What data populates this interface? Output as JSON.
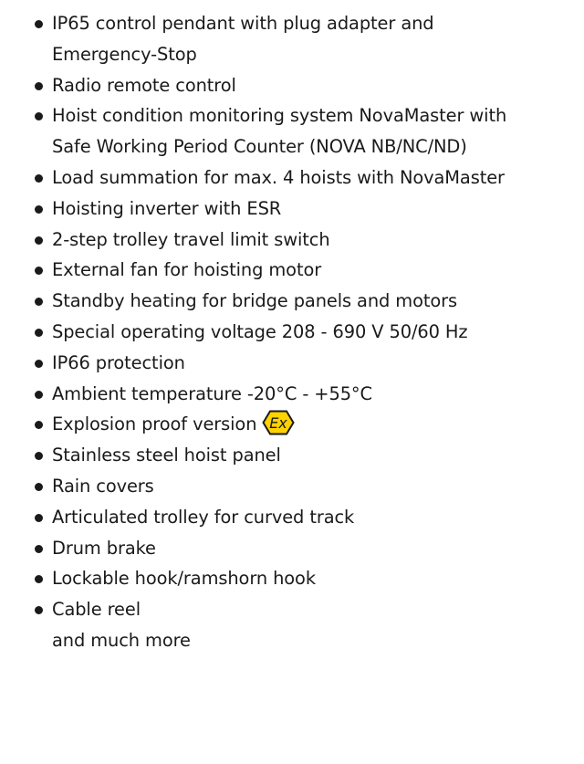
{
  "features": {
    "items": [
      {
        "lines": [
          "IP65 control pendant with plug adapter and",
          "Emergency-Stop"
        ]
      },
      {
        "lines": [
          "Radio remote control"
        ]
      },
      {
        "lines": [
          "Hoist condition monitoring system NovaMaster with",
          "Safe Working Period Counter (NOVA NB/NC/ND)"
        ]
      },
      {
        "lines": [
          "Load summation for max. 4 hoists with NovaMaster"
        ]
      },
      {
        "lines": [
          "Hoisting inverter with ESR"
        ]
      },
      {
        "lines": [
          "2-step trolley travel limit switch"
        ]
      },
      {
        "lines": [
          "External fan for hoisting motor"
        ]
      },
      {
        "lines": [
          "Standby heating for bridge panels and motors"
        ]
      },
      {
        "lines": [
          "Special operating voltage 208 - 690 V 50/60 Hz"
        ]
      },
      {
        "lines": [
          "IP66 protection"
        ]
      },
      {
        "lines": [
          "Ambient temperature -20°C - +55°C"
        ]
      },
      {
        "lines": [
          "Explosion proof version"
        ],
        "icon": "ex-explosion-proof-icon",
        "icon_text": "Ex"
      },
      {
        "lines": [
          "Stainless steel hoist panel"
        ]
      },
      {
        "lines": [
          "Rain covers"
        ]
      },
      {
        "lines": [
          "Articulated trolley for curved track"
        ]
      },
      {
        "lines": [
          "Drum brake"
        ]
      },
      {
        "lines": [
          "Lockable hook/ramshorn hook"
        ]
      },
      {
        "lines": [
          "Cable reel"
        ]
      }
    ],
    "footer": "and much more"
  },
  "colors": {
    "text": "#1a1a1a",
    "ex_icon_fill": "#ffd200",
    "ex_icon_stroke": "#1a1a1a"
  }
}
